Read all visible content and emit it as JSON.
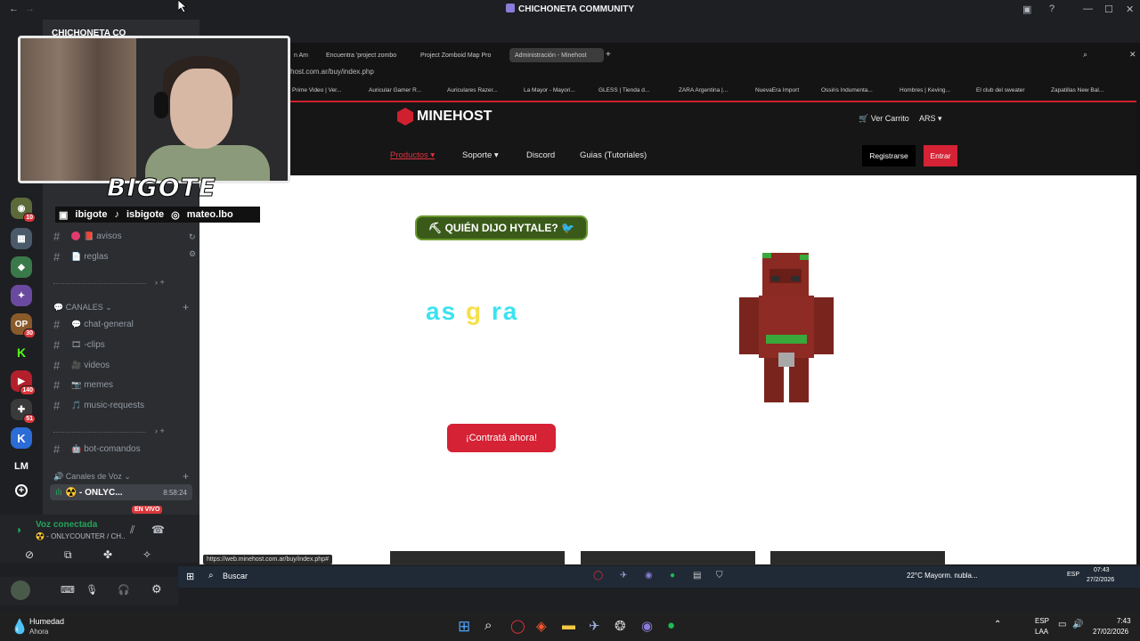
{
  "window": {
    "title": "CHICHONETA COMMUNITY"
  },
  "server": {
    "name": "CHICHONETA CO"
  },
  "rail": {
    "badges": [
      "10",
      "30",
      "140",
      "51"
    ],
    "lm_label": "LM",
    "add_label": "+"
  },
  "channels": {
    "info": [
      {
        "name": "avisos",
        "emoji": "📕"
      },
      {
        "name": "reglas",
        "emoji": "📄"
      }
    ],
    "category_text": "CANALES",
    "text": [
      {
        "name": "chat-general",
        "emoji": "💬"
      },
      {
        "name": "-clips",
        "emoji": "🎞"
      },
      {
        "name": "videos",
        "emoji": "🎥"
      },
      {
        "name": "memes",
        "emoji": "📷"
      },
      {
        "name": "music-requests",
        "emoji": "🎵"
      }
    ],
    "bot": {
      "name": "bot-comandos",
      "emoji": "🤖"
    },
    "category_voice": "Canales de Voz",
    "voice_channel": "☢️ - ONLYC...",
    "voice_timer": "8:58:24",
    "live_badge": "EN VIVO"
  },
  "voice_panel": {
    "status": "Voz conectada",
    "channel": "☢️ - ONLYCOUNTER / CH..."
  },
  "webcam": {
    "streamer_name": "BIGOTE",
    "socials": [
      "ibigote",
      "isbigote",
      "mateo.lbo"
    ]
  },
  "browser": {
    "tabs": [
      {
        "label": "n Am"
      },
      {
        "label": "Encuentra 'project zombo"
      },
      {
        "label": "Project Zomboid Map Pro"
      },
      {
        "label": "Administración - Minehost",
        "active": true
      }
    ],
    "url": "host.com.ar/buy/index.php",
    "bookmarks": [
      "Prime Video | Ver...",
      "Auricular Gamer R...",
      "Auriculares Razer...",
      "La Mayor - Mayori...",
      "GLESS | Tienda d...",
      "ZARA Argentina |...",
      "NuevaEra Import",
      "Ossiris Indumenta...",
      "Hombres | Keving...",
      "El club del sweater",
      "Zapatillas New Bal..."
    ],
    "status_url": "https://web.minehost.com.ar/buy/index.php#"
  },
  "site": {
    "brand": "MINEHOST",
    "cart_label": "Ver Carrito",
    "currency": "ARS",
    "nav": [
      "Productos",
      "Soporte",
      "Discord",
      "Guias (Tutoriales)"
    ],
    "register_label": "Registrarse",
    "login_label": "Entrar",
    "promo_label": "⛏ QUIÉN DIJO HYTALE? 🐦",
    "anim_text_a": "as ",
    "anim_text_b": "g",
    "anim_text_c": " ra",
    "cta_label": "¡Contratá ahora!"
  },
  "inner_taskbar": {
    "search_label": "Buscar",
    "weather": "22°C  Mayorm. nubla...",
    "lang": "ESP",
    "time": "07:43",
    "date": "27/2/2026"
  },
  "taskbar": {
    "widget_title": "Humedad",
    "widget_sub": "Ahora",
    "lang_top": "ESP",
    "lang_bottom": "LAA",
    "time": "7:43",
    "date": "27/02/2026"
  },
  "colors": {
    "accent": "#d52235",
    "discord_bg": "#2b2d31",
    "promo_green": "#3a5a1a"
  }
}
